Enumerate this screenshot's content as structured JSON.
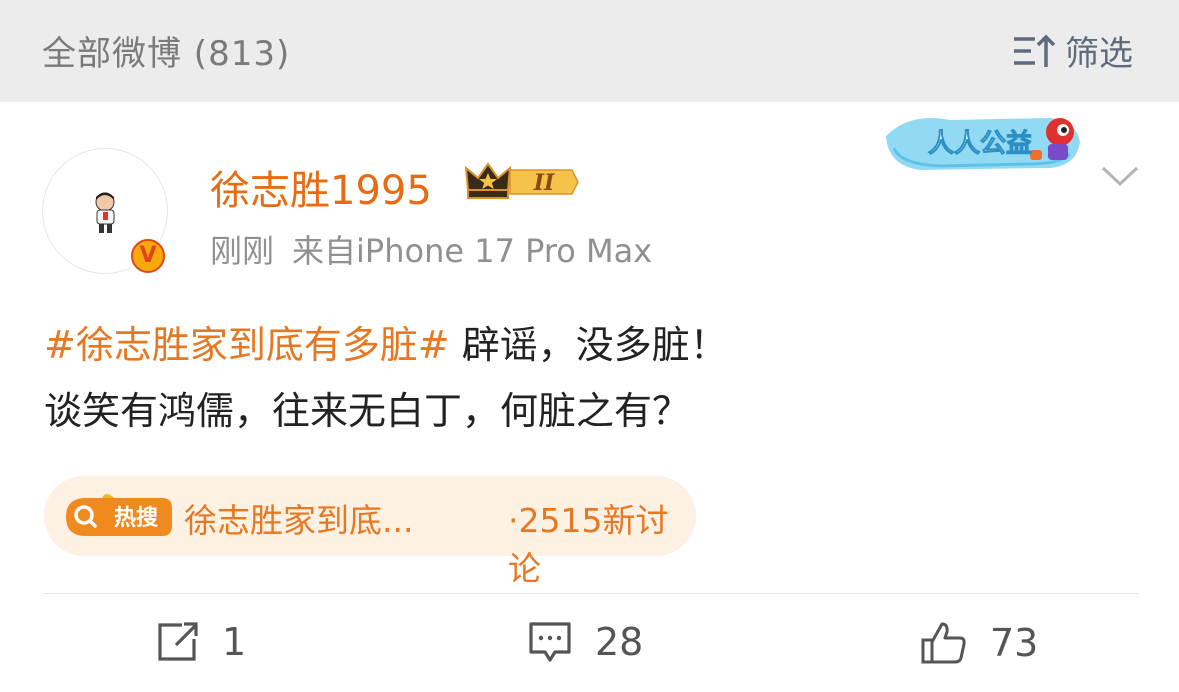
{
  "topbar": {
    "title": "全部微博 (813)",
    "filter_label": "筛选",
    "filter_icon": "filter-icon"
  },
  "post": {
    "username": "徐志胜1995",
    "level_badge": "II",
    "verified_badge": "V",
    "time": "刚刚",
    "source": "来自iPhone 17 Pro Max",
    "charity_badge": "人人公益",
    "content": {
      "hashtag": "#徐志胜家到底有多脏#",
      "line1_rest": " 辟谣，没多脏！",
      "line2": "谈笑有鸿儒，往来无白丁，何脏之有？"
    },
    "hot_search": {
      "badge_label": "热搜",
      "title": "徐志胜家到底...",
      "count": "·2515新讨论"
    },
    "actions": {
      "share_count": "1",
      "comment_count": "28",
      "like_count": "73"
    }
  },
  "colors": {
    "accent_orange": "#e87722",
    "username_orange": "#e76b12",
    "topbar_bg": "#ececec",
    "hot_bg": "#fdf1e4"
  }
}
